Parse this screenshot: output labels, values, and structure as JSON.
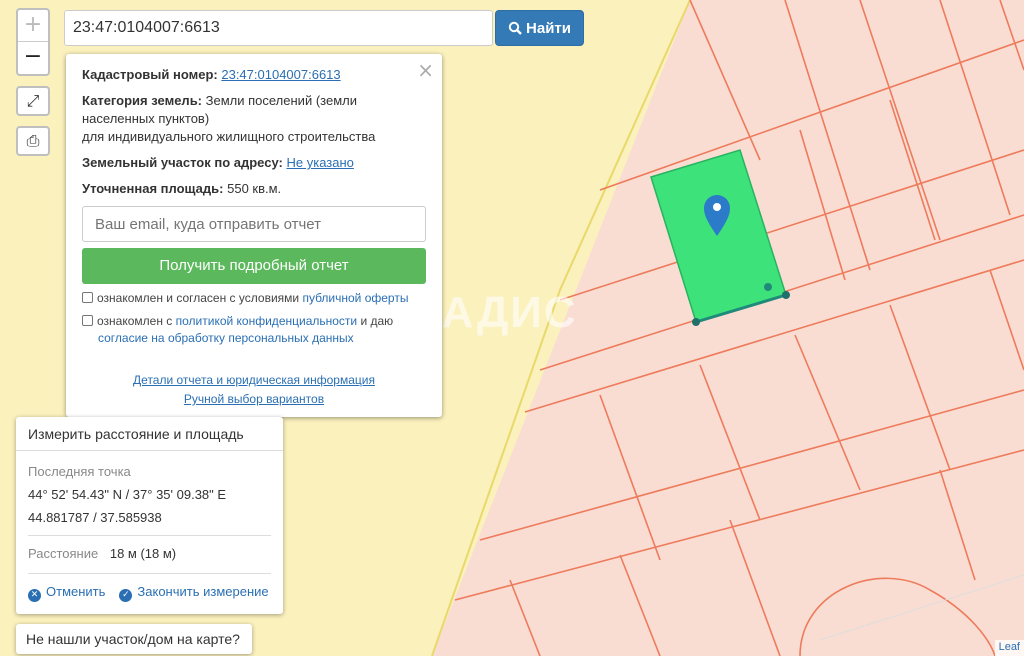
{
  "search": {
    "value": "23:47:0104007:6613",
    "button_label": "Найти"
  },
  "zoom": {
    "in": "+",
    "out": "−"
  },
  "popup": {
    "cadastral_label": "Кадастровый номер:",
    "cadastral_value": "23:47:0104007:6613",
    "category_label": "Категория земель:",
    "category_value": "Земли поселений (земли",
    "category_line2": "населенных пунктов)",
    "category_line3": "для индивидуального жилищного строительства",
    "address_label": "Земельный участок по адресу:",
    "address_value": "Не указано",
    "area_label": "Уточненная площадь:",
    "area_value": "550 кв.м.",
    "email_placeholder": "Ваш email, куда отправить отчет",
    "report_button": "Получить подробный отчет",
    "check1_text": "ознакомлен и согласен с условиями",
    "check1_link": "публичной оферты",
    "check2_text": "ознакомлен с",
    "check2_link": "политикой конфиденциальности",
    "check2_tail": "и даю",
    "check2_link2": "согласие на обработку персональных данных",
    "details_link": "Детали отчета и юридическая информация",
    "manual_link": "Ручной выбор вариантов",
    "close": "×"
  },
  "measure": {
    "title": "Измерить расстояние и площадь",
    "last_point_label": "Последняя точка",
    "coords_dms": "44° 52' 54.43\" N / 37° 35' 09.38\" E",
    "coords_dec": "44.881787 / 37.585938",
    "distance_label": "Расстояние",
    "distance_value": "18 м (18 м)",
    "cancel": "Отменить",
    "finish": "Закончить измерение"
  },
  "not_found": "Не нашли участок/дом на карте?",
  "watermark": "ВЛАДИС",
  "attribution": "Leaf",
  "colors": {
    "parcel_fill": "#f9ddd3",
    "parcel_line": "#ee7b5c",
    "selected": "#3de27a",
    "background": "#fbf1bd",
    "accent": "#337ab7"
  }
}
